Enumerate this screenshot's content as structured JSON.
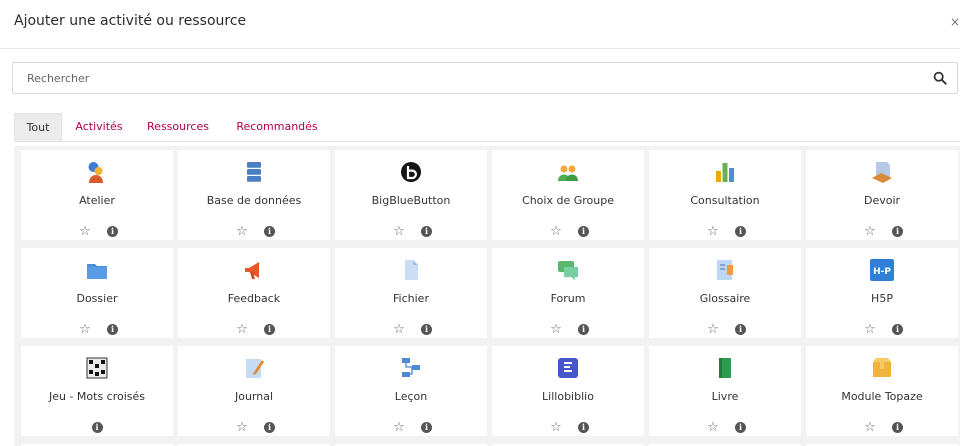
{
  "modal": {
    "title": "Ajouter une activité ou ressource",
    "close_label": "×"
  },
  "search": {
    "placeholder": "Rechercher"
  },
  "tabs": [
    {
      "label": "Tout"
    },
    {
      "label": "Activités"
    },
    {
      "label": "Ressources"
    },
    {
      "label": "Recommandés"
    }
  ],
  "items": [
    {
      "label": "Atelier",
      "icon": "workshop-icon"
    },
    {
      "label": "Base de données",
      "icon": "database-icon"
    },
    {
      "label": "BigBlueButton",
      "icon": "bigbluebutton-icon"
    },
    {
      "label": "Choix de Groupe",
      "icon": "group-choice-icon"
    },
    {
      "label": "Consultation",
      "icon": "chart-icon"
    },
    {
      "label": "Devoir",
      "icon": "assignment-icon"
    },
    {
      "label": "Dossier",
      "icon": "folder-icon"
    },
    {
      "label": "Feedback",
      "icon": "megaphone-icon"
    },
    {
      "label": "Fichier",
      "icon": "file-icon"
    },
    {
      "label": "Forum",
      "icon": "forum-icon"
    },
    {
      "label": "Glossaire",
      "icon": "glossary-icon"
    },
    {
      "label": "H5P",
      "icon": "h5p-icon"
    },
    {
      "label": "Jeu - Mots croisés",
      "icon": "crossword-icon"
    },
    {
      "label": "Journal",
      "icon": "journal-icon"
    },
    {
      "label": "Leçon",
      "icon": "lesson-icon"
    },
    {
      "label": "Lillobiblio",
      "icon": "lillobiblio-icon"
    },
    {
      "label": "Livre",
      "icon": "book-icon"
    },
    {
      "label": "Module Topaze",
      "icon": "topaze-icon"
    }
  ],
  "icons": {
    "star": "☆",
    "info": "i",
    "h5p_text": "H-P"
  },
  "colors": {
    "accent": "#b1004f",
    "tab_active_bg": "#ececec",
    "grid_bg": "#f2f2f2"
  }
}
